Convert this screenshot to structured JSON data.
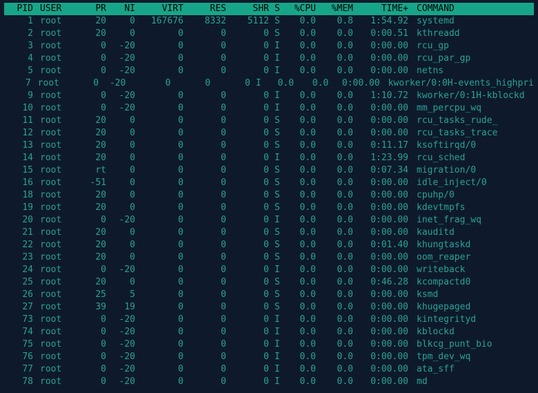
{
  "headers": {
    "pid": "PID",
    "user": "USER",
    "pr": "PR",
    "ni": "NI",
    "virt": "VIRT",
    "res": "RES",
    "shr": "SHR",
    "s": "S",
    "cpu": "%CPU",
    "mem": "%MEM",
    "time": "TIME+",
    "cmd": "COMMAND"
  },
  "rows": [
    {
      "pid": "1",
      "user": "root",
      "pr": "20",
      "ni": "0",
      "virt": "167676",
      "res": "8332",
      "shr": "5112",
      "s": "S",
      "cpu": "0.0",
      "mem": "0.8",
      "time": "1:54.92",
      "cmd": "systemd"
    },
    {
      "pid": "2",
      "user": "root",
      "pr": "20",
      "ni": "0",
      "virt": "0",
      "res": "0",
      "shr": "0",
      "s": "S",
      "cpu": "0.0",
      "mem": "0.0",
      "time": "0:00.51",
      "cmd": "kthreadd"
    },
    {
      "pid": "3",
      "user": "root",
      "pr": "0",
      "ni": "-20",
      "virt": "0",
      "res": "0",
      "shr": "0",
      "s": "I",
      "cpu": "0.0",
      "mem": "0.0",
      "time": "0:00.00",
      "cmd": "rcu_gp"
    },
    {
      "pid": "4",
      "user": "root",
      "pr": "0",
      "ni": "-20",
      "virt": "0",
      "res": "0",
      "shr": "0",
      "s": "I",
      "cpu": "0.0",
      "mem": "0.0",
      "time": "0:00.00",
      "cmd": "rcu_par_gp"
    },
    {
      "pid": "5",
      "user": "root",
      "pr": "0",
      "ni": "-20",
      "virt": "0",
      "res": "0",
      "shr": "0",
      "s": "I",
      "cpu": "0.0",
      "mem": "0.0",
      "time": "0:00.00",
      "cmd": "netns"
    },
    {
      "pid": "7",
      "user": "root",
      "pr": "0",
      "ni": "-20",
      "virt": "0",
      "res": "0",
      "shr": "0",
      "s": "I",
      "cpu": "0.0",
      "mem": "0.0",
      "time": "0:00.00",
      "cmd": "kworker/0:0H-events_highpri"
    },
    {
      "pid": "9",
      "user": "root",
      "pr": "0",
      "ni": "-20",
      "virt": "0",
      "res": "0",
      "shr": "0",
      "s": "I",
      "cpu": "0.0",
      "mem": "0.0",
      "time": "1:10.72",
      "cmd": "kworker/0:1H-kblockd"
    },
    {
      "pid": "10",
      "user": "root",
      "pr": "0",
      "ni": "-20",
      "virt": "0",
      "res": "0",
      "shr": "0",
      "s": "I",
      "cpu": "0.0",
      "mem": "0.0",
      "time": "0:00.00",
      "cmd": "mm_percpu_wq"
    },
    {
      "pid": "11",
      "user": "root",
      "pr": "20",
      "ni": "0",
      "virt": "0",
      "res": "0",
      "shr": "0",
      "s": "S",
      "cpu": "0.0",
      "mem": "0.0",
      "time": "0:00.00",
      "cmd": "rcu_tasks_rude_"
    },
    {
      "pid": "12",
      "user": "root",
      "pr": "20",
      "ni": "0",
      "virt": "0",
      "res": "0",
      "shr": "0",
      "s": "S",
      "cpu": "0.0",
      "mem": "0.0",
      "time": "0:00.00",
      "cmd": "rcu_tasks_trace"
    },
    {
      "pid": "13",
      "user": "root",
      "pr": "20",
      "ni": "0",
      "virt": "0",
      "res": "0",
      "shr": "0",
      "s": "S",
      "cpu": "0.0",
      "mem": "0.0",
      "time": "0:11.17",
      "cmd": "ksoftirqd/0"
    },
    {
      "pid": "14",
      "user": "root",
      "pr": "20",
      "ni": "0",
      "virt": "0",
      "res": "0",
      "shr": "0",
      "s": "I",
      "cpu": "0.0",
      "mem": "0.0",
      "time": "1:23.99",
      "cmd": "rcu_sched"
    },
    {
      "pid": "15",
      "user": "root",
      "pr": "rt",
      "ni": "0",
      "virt": "0",
      "res": "0",
      "shr": "0",
      "s": "S",
      "cpu": "0.0",
      "mem": "0.0",
      "time": "0:07.34",
      "cmd": "migration/0"
    },
    {
      "pid": "16",
      "user": "root",
      "pr": "-51",
      "ni": "0",
      "virt": "0",
      "res": "0",
      "shr": "0",
      "s": "S",
      "cpu": "0.0",
      "mem": "0.0",
      "time": "0:00.00",
      "cmd": "idle_inject/0"
    },
    {
      "pid": "18",
      "user": "root",
      "pr": "20",
      "ni": "0",
      "virt": "0",
      "res": "0",
      "shr": "0",
      "s": "S",
      "cpu": "0.0",
      "mem": "0.0",
      "time": "0:00.00",
      "cmd": "cpuhp/0"
    },
    {
      "pid": "19",
      "user": "root",
      "pr": "20",
      "ni": "0",
      "virt": "0",
      "res": "0",
      "shr": "0",
      "s": "S",
      "cpu": "0.0",
      "mem": "0.0",
      "time": "0:00.00",
      "cmd": "kdevtmpfs"
    },
    {
      "pid": "20",
      "user": "root",
      "pr": "0",
      "ni": "-20",
      "virt": "0",
      "res": "0",
      "shr": "0",
      "s": "I",
      "cpu": "0.0",
      "mem": "0.0",
      "time": "0:00.00",
      "cmd": "inet_frag_wq"
    },
    {
      "pid": "21",
      "user": "root",
      "pr": "20",
      "ni": "0",
      "virt": "0",
      "res": "0",
      "shr": "0",
      "s": "S",
      "cpu": "0.0",
      "mem": "0.0",
      "time": "0:00.00",
      "cmd": "kauditd"
    },
    {
      "pid": "22",
      "user": "root",
      "pr": "20",
      "ni": "0",
      "virt": "0",
      "res": "0",
      "shr": "0",
      "s": "S",
      "cpu": "0.0",
      "mem": "0.0",
      "time": "0:01.40",
      "cmd": "khungtaskd"
    },
    {
      "pid": "23",
      "user": "root",
      "pr": "20",
      "ni": "0",
      "virt": "0",
      "res": "0",
      "shr": "0",
      "s": "S",
      "cpu": "0.0",
      "mem": "0.0",
      "time": "0:00.00",
      "cmd": "oom_reaper"
    },
    {
      "pid": "24",
      "user": "root",
      "pr": "0",
      "ni": "-20",
      "virt": "0",
      "res": "0",
      "shr": "0",
      "s": "I",
      "cpu": "0.0",
      "mem": "0.0",
      "time": "0:00.00",
      "cmd": "writeback"
    },
    {
      "pid": "25",
      "user": "root",
      "pr": "20",
      "ni": "0",
      "virt": "0",
      "res": "0",
      "shr": "0",
      "s": "S",
      "cpu": "0.0",
      "mem": "0.0",
      "time": "0:46.28",
      "cmd": "kcompactd0"
    },
    {
      "pid": "26",
      "user": "root",
      "pr": "25",
      "ni": "5",
      "virt": "0",
      "res": "0",
      "shr": "0",
      "s": "S",
      "cpu": "0.0",
      "mem": "0.0",
      "time": "0:00.00",
      "cmd": "ksmd"
    },
    {
      "pid": "27",
      "user": "root",
      "pr": "39",
      "ni": "19",
      "virt": "0",
      "res": "0",
      "shr": "0",
      "s": "S",
      "cpu": "0.0",
      "mem": "0.0",
      "time": "0:00.00",
      "cmd": "khugepaged"
    },
    {
      "pid": "73",
      "user": "root",
      "pr": "0",
      "ni": "-20",
      "virt": "0",
      "res": "0",
      "shr": "0",
      "s": "I",
      "cpu": "0.0",
      "mem": "0.0",
      "time": "0:00.00",
      "cmd": "kintegrityd"
    },
    {
      "pid": "74",
      "user": "root",
      "pr": "0",
      "ni": "-20",
      "virt": "0",
      "res": "0",
      "shr": "0",
      "s": "I",
      "cpu": "0.0",
      "mem": "0.0",
      "time": "0:00.00",
      "cmd": "kblockd"
    },
    {
      "pid": "75",
      "user": "root",
      "pr": "0",
      "ni": "-20",
      "virt": "0",
      "res": "0",
      "shr": "0",
      "s": "I",
      "cpu": "0.0",
      "mem": "0.0",
      "time": "0:00.00",
      "cmd": "blkcg_punt_bio"
    },
    {
      "pid": "76",
      "user": "root",
      "pr": "0",
      "ni": "-20",
      "virt": "0",
      "res": "0",
      "shr": "0",
      "s": "I",
      "cpu": "0.0",
      "mem": "0.0",
      "time": "0:00.00",
      "cmd": "tpm_dev_wq"
    },
    {
      "pid": "77",
      "user": "root",
      "pr": "0",
      "ni": "-20",
      "virt": "0",
      "res": "0",
      "shr": "0",
      "s": "I",
      "cpu": "0.0",
      "mem": "0.0",
      "time": "0:00.00",
      "cmd": "ata_sff"
    },
    {
      "pid": "78",
      "user": "root",
      "pr": "0",
      "ni": "-20",
      "virt": "0",
      "res": "0",
      "shr": "0",
      "s": "I",
      "cpu": "0.0",
      "mem": "0.0",
      "time": "0:00.00",
      "cmd": "md"
    }
  ]
}
